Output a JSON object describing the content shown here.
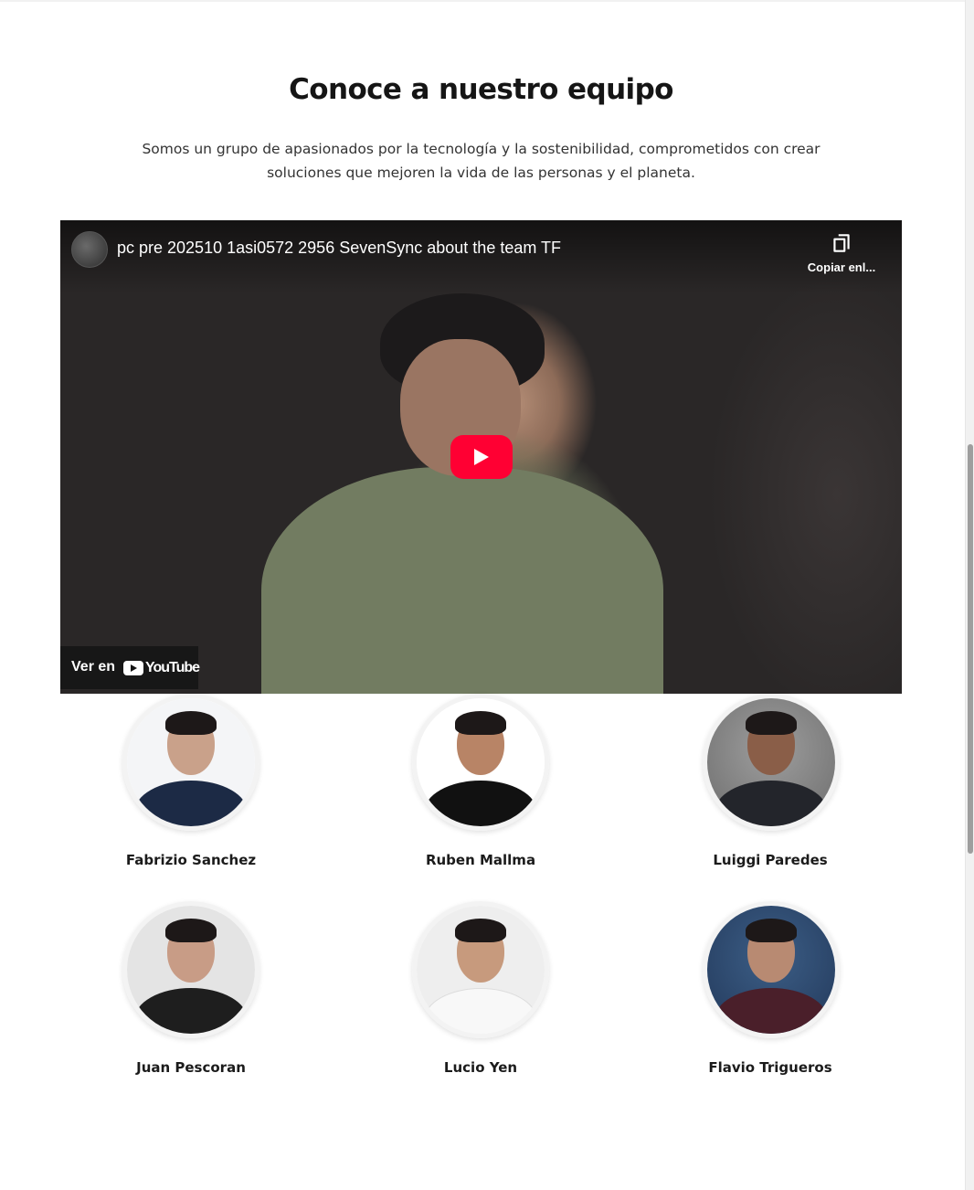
{
  "section": {
    "title": "Conoce a nuestro equipo",
    "subtitle": "Somos un grupo de apasionados por la tecnología y la sostenibilidad, comprometidos con crear soluciones que mejoren la vida de las personas y el planeta."
  },
  "video": {
    "title": "pc pre 202510 1asi0572 2956 SevenSync about the team TF",
    "copy_link_label": "Copiar enl...",
    "watch_on_label": "Ver en",
    "youtube_brand": "YouTube",
    "play_icon": "play-icon",
    "copy_icon": "copy-icon",
    "accent_color": "#ff0033"
  },
  "team": [
    {
      "name": "Fabrizio Sanchez"
    },
    {
      "name": "Ruben Mallma"
    },
    {
      "name": "Luiggi Paredes"
    },
    {
      "name": "Juan Pescoran"
    },
    {
      "name": "Lucio Yen"
    },
    {
      "name": "Flavio Trigueros"
    }
  ]
}
